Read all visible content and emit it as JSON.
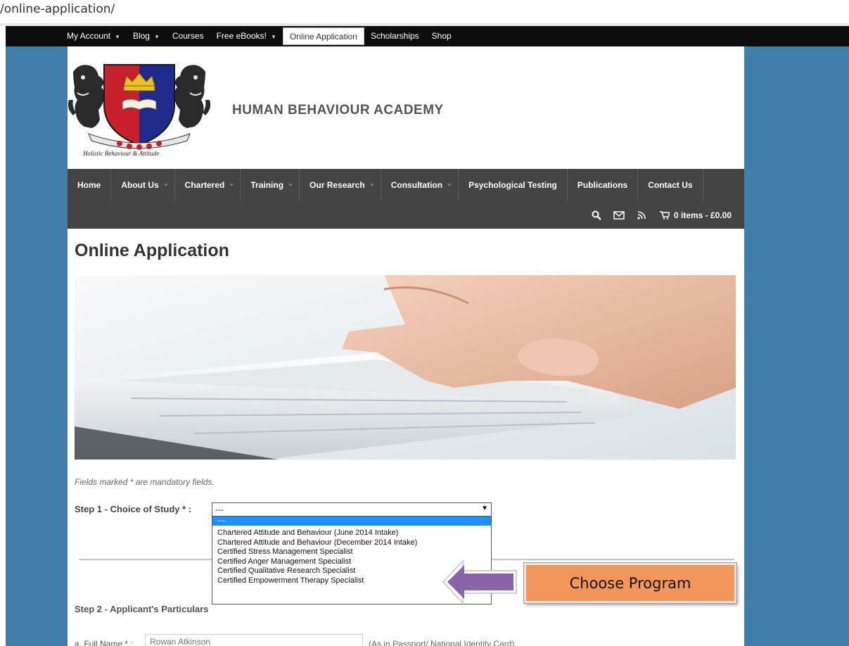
{
  "browser": {
    "url_fragment": "/online-application/"
  },
  "top_nav": [
    {
      "label": "My Account",
      "dropdown": true
    },
    {
      "label": "Blog",
      "dropdown": true
    },
    {
      "label": "Courses",
      "dropdown": false
    },
    {
      "label": "Free eBooks!",
      "dropdown": true
    },
    {
      "label": "Online Application",
      "dropdown": false,
      "active": true
    },
    {
      "label": "Scholarships",
      "dropdown": false
    },
    {
      "label": "Shop",
      "dropdown": false
    }
  ],
  "header": {
    "site_title": "HUMAN BEHAVIOUR ACADEMY",
    "logo_motto": "Holistic Behaviour & Attitude"
  },
  "main_nav": [
    {
      "label": "Home",
      "dropdown": false
    },
    {
      "label": "About Us",
      "dropdown": true
    },
    {
      "label": "Chartered",
      "dropdown": true
    },
    {
      "label": "Training",
      "dropdown": true
    },
    {
      "label": "Our Research",
      "dropdown": true
    },
    {
      "label": "Consultation",
      "dropdown": true
    },
    {
      "label": "Psychological Testing",
      "dropdown": false
    },
    {
      "label": "Publications",
      "dropdown": false
    },
    {
      "label": "Contact Us",
      "dropdown": false
    }
  ],
  "utility": {
    "icons": [
      "search-icon",
      "mail-icon",
      "rss-icon",
      "cart-icon"
    ],
    "cart_label": "0 items - £0.00"
  },
  "page": {
    "title": "Online Application",
    "mandatory_note": "Fields marked * are mandatory fields."
  },
  "step1": {
    "label": "Step 1 - Choice of Study * :",
    "selected": "---",
    "options": [
      "---",
      "Chartered Attitude and Behaviour (June 2014 Intake)",
      "Chartered Attitude and Behaviour (December 2014 Intake)",
      "Certified Stress Management Specialist",
      "Certified Anger Management Specialist",
      "Certified Qualitative Research Specialist",
      "Certified Empowerment Therapy Specialist"
    ]
  },
  "step2": {
    "label": "Step 2 - Applicant's Particulars",
    "full_name_label": "a. Full Name * :",
    "full_name_placeholder": "Rowan Atkinson",
    "full_name_hint": "(As in Passport/ National Identity Card)"
  },
  "callout": {
    "text": "Choose Program"
  },
  "colors": {
    "page_background": "#3f7fa9",
    "top_bar": "#0d0d0d",
    "main_nav": "#444444",
    "dropdown_highlight": "#1e90ff",
    "callout_fill": "#f3965a",
    "arrow_fill": "#8a64a6"
  }
}
